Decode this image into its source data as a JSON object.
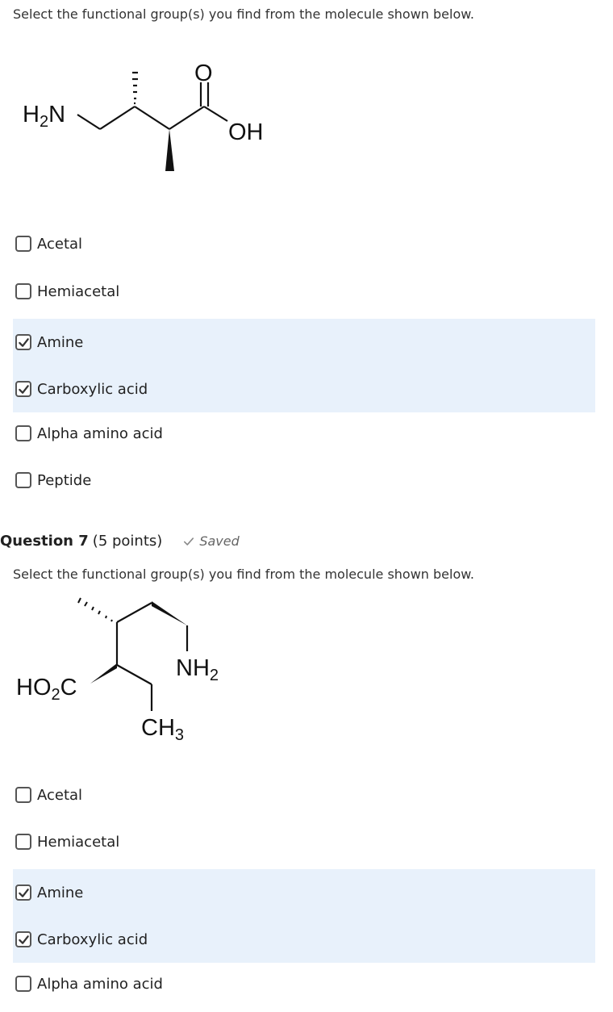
{
  "q6": {
    "prompt": "Select the functional group(s) you find from the molecule shown below.",
    "molecule_labels": {
      "amine": "H2N",
      "carbonyl_o": "O",
      "hydroxyl": "OH"
    },
    "options": [
      {
        "label": "Acetal",
        "checked": false
      },
      {
        "label": "Hemiacetal",
        "checked": false
      },
      {
        "label": "Amine",
        "checked": true
      },
      {
        "label": "Carboxylic acid",
        "checked": true
      },
      {
        "label": "Alpha amino acid",
        "checked": false
      },
      {
        "label": "Peptide",
        "checked": false
      }
    ]
  },
  "q7": {
    "title": "Question 7",
    "points": "(5 points)",
    "saved": "Saved",
    "prompt": "Select the functional group(s) you find from the molecule shown below.",
    "molecule_labels": {
      "acid": "HO2C",
      "amine": "NH2",
      "methyl": "CH3"
    },
    "options": [
      {
        "label": "Acetal",
        "checked": false
      },
      {
        "label": "Hemiacetal",
        "checked": false
      },
      {
        "label": "Amine",
        "checked": true
      },
      {
        "label": "Carboxylic acid",
        "checked": true
      },
      {
        "label": "Alpha amino acid",
        "checked": false
      }
    ]
  },
  "colors": {
    "selected_bg": "#e8f1fb",
    "checkbox_border": "#555555",
    "saved_text": "#666666"
  },
  "icons": {
    "checked": "checkmark-icon",
    "saved": "saved-check-icon"
  }
}
